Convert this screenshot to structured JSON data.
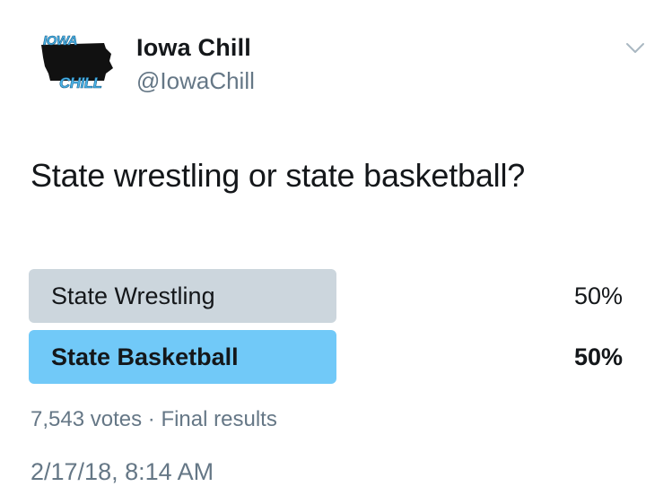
{
  "author": {
    "display_name": "Iowa Chill",
    "handle": "@IowaChill",
    "avatar_logo_text_top": "IOWA",
    "avatar_logo_text_bottom": "CHILL",
    "avatar_icon": "iowa-chill-logo",
    "menu_icon": "chevron-down-icon"
  },
  "tweet": {
    "text": "State wrestling or state basketball?",
    "timestamp": "2/17/18, 8:14 AM"
  },
  "poll": {
    "options": [
      {
        "label": "State Wrestling",
        "percent_text": "50%",
        "percent": 50,
        "winner": false
      },
      {
        "label": "State Basketball",
        "percent_text": "50%",
        "percent": 50,
        "winner": true
      }
    ],
    "votes_text": "7,543 votes",
    "separator": "·",
    "status_text": "Final results"
  },
  "colors": {
    "text_primary": "#14171a",
    "text_secondary": "#657786",
    "bar_neutral": "#ccd6dd",
    "bar_winner": "#71c9f8",
    "logo_blue": "#4ab3e8"
  }
}
